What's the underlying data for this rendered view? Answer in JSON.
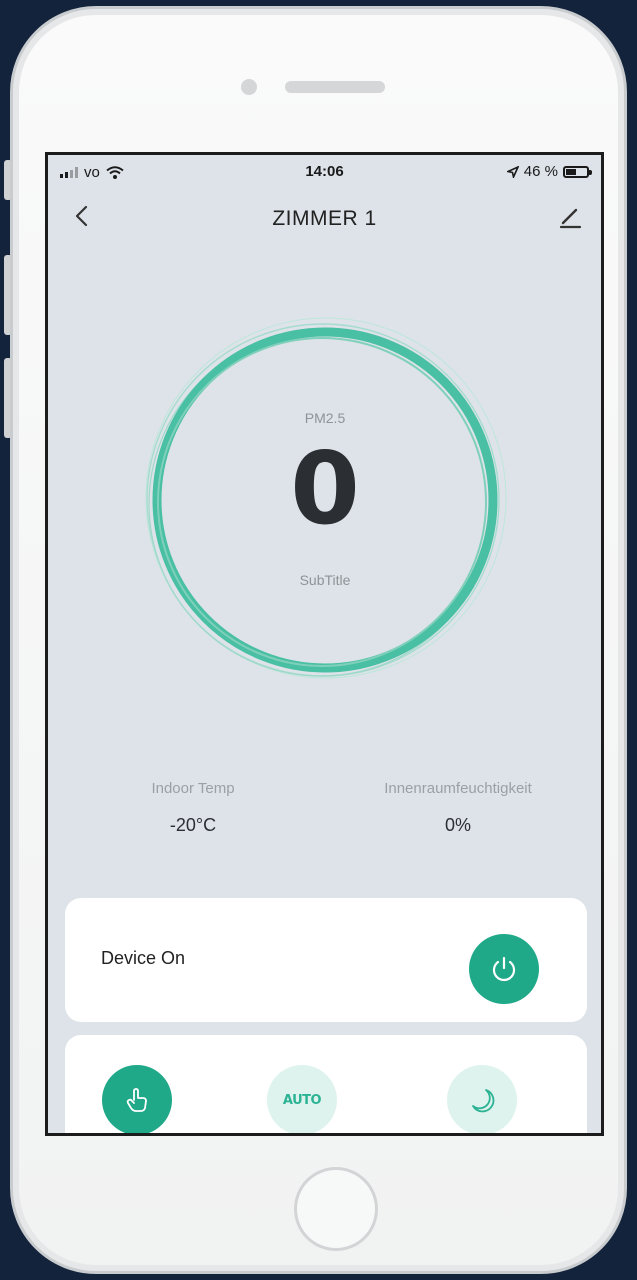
{
  "status_bar": {
    "carrier": "vo",
    "time": "14:06",
    "battery": "46 %"
  },
  "header": {
    "title": "ZIMMER 1"
  },
  "gauge": {
    "label": "PM2.5",
    "value": "0",
    "subtitle": "SubTitle"
  },
  "stats": [
    {
      "label": "Indoor Temp",
      "value": "-20°C"
    },
    {
      "label": "Innenraumfeuchtigkeit",
      "value": "0%"
    }
  ],
  "device": {
    "label": "Device On"
  },
  "modes": [
    {
      "icon": "hand-pointer-icon",
      "state": "active"
    },
    {
      "label": "AUTO",
      "state": "inactive"
    },
    {
      "icon": "moon-icon",
      "state": "inactive"
    }
  ],
  "colors": {
    "accent": "#1fa988",
    "screen_bg": "#dde3e8"
  }
}
